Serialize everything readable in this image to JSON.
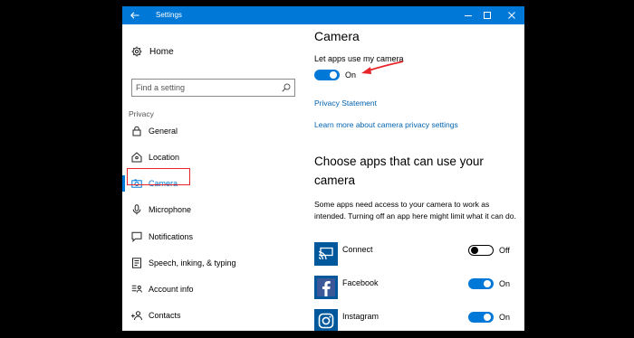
{
  "window": {
    "title": "Settings"
  },
  "sidebar": {
    "home_label": "Home",
    "search_placeholder": "Find a setting",
    "section_label": "Privacy",
    "items": [
      {
        "label": "General",
        "icon": "lock-icon"
      },
      {
        "label": "Location",
        "icon": "location-icon"
      },
      {
        "label": "Camera",
        "icon": "camera-icon",
        "selected": true
      },
      {
        "label": "Microphone",
        "icon": "microphone-icon"
      },
      {
        "label": "Notifications",
        "icon": "notifications-icon"
      },
      {
        "label": "Speech, inking, & typing",
        "icon": "speech-icon"
      },
      {
        "label": "Account info",
        "icon": "account-info-icon"
      },
      {
        "label": "Contacts",
        "icon": "contacts-icon"
      }
    ]
  },
  "content": {
    "title": "Camera",
    "toggle_label": "Let apps use my camera",
    "toggle_state": "On",
    "privacy_statement_link": "Privacy Statement",
    "learn_more_link": "Learn more about camera privacy settings",
    "apps_heading": "Choose apps that can use your camera",
    "apps_description": "Some apps need access to your camera to work as intended. Turning off an app here might limit what it can do.",
    "apps": [
      {
        "name": "Connect",
        "state": "Off",
        "on": false,
        "icon": "connect-app-icon"
      },
      {
        "name": "Facebook",
        "state": "On",
        "on": true,
        "icon": "facebook-app-icon"
      },
      {
        "name": "Instagram",
        "state": "On",
        "on": true,
        "icon": "instagram-app-icon"
      }
    ]
  },
  "colors": {
    "accent": "#0078d7",
    "link": "#0063b1",
    "highlight_box": "#e8262a",
    "app_tile": "#00589c"
  }
}
